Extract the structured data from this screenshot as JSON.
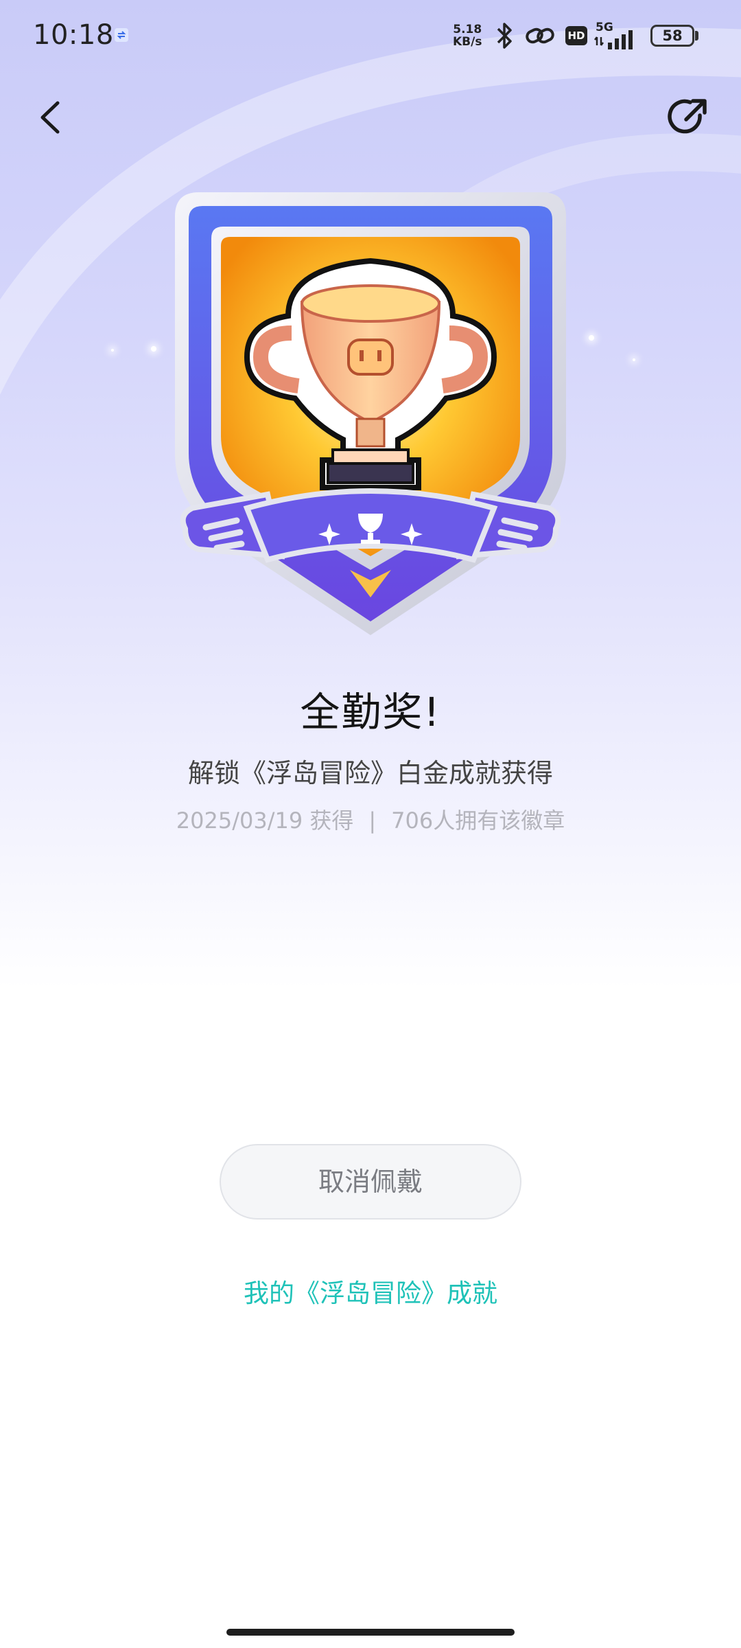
{
  "status_bar": {
    "time": "10:18",
    "net_speed_value": "5.18",
    "net_speed_unit": "KB/s",
    "hd_label": "HD",
    "network_label": "5G",
    "battery": "58"
  },
  "badge": {
    "title": "全勤奖!",
    "description": "解锁《浮岛冒险》白金成就获得",
    "earned_date": "2025/03/19 获得",
    "separator": "|",
    "owners": "706人拥有该徽章"
  },
  "actions": {
    "unwear_label": "取消佩戴",
    "achievements_link": "我的《浮岛冒险》成就"
  },
  "colors": {
    "accent": "#1fc2b8",
    "shield_blue": "#5b5ef0",
    "trophy_gold": "#f5a623"
  }
}
